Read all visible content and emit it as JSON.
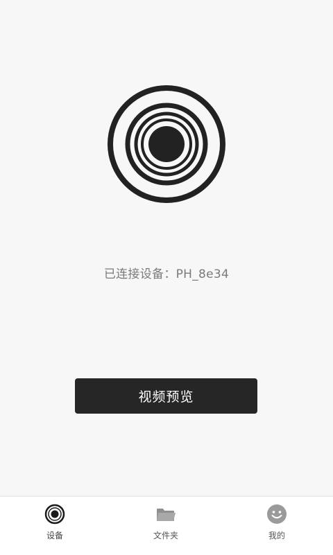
{
  "status": {
    "text": "已连接设备：PH_8e34"
  },
  "actions": {
    "preview_label": "视频预览"
  },
  "tabbar": {
    "tabs": [
      {
        "label": "设备",
        "icon": "camera-lens-icon",
        "active": true
      },
      {
        "label": "文件夹",
        "icon": "folder-icon",
        "active": false
      },
      {
        "label": "我的",
        "icon": "smiley-face-icon",
        "active": false
      }
    ]
  },
  "colors": {
    "background": "#f7f7f7",
    "button": "#262626",
    "status_text": "#7a7a7a",
    "icon_inactive": "#9a9a9a"
  }
}
